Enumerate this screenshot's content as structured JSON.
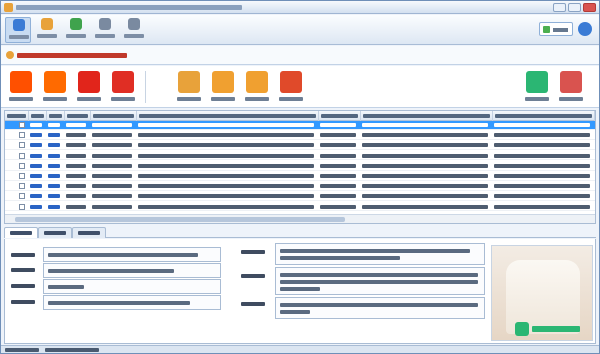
{
  "accent_colors": {
    "selected_row": "#3399ff",
    "link": "#2a64c5",
    "notice": "#c0392b"
  },
  "toolbar": {
    "buttons": [
      {
        "icon": "home-icon",
        "color": "#3a7bd5"
      },
      {
        "icon": "video-tutorial-icon",
        "color": "#e8a23a"
      },
      {
        "icon": "qq-group-icon",
        "color": "#3fa34d"
      },
      {
        "icon": "run-log-icon",
        "color": "#7a8aa0"
      },
      {
        "icon": "register-icon",
        "color": "#7a8aa0"
      }
    ],
    "skin_icon": "skin-icon",
    "help_icon": "help-icon"
  },
  "stores": [
    {
      "icon": "taobao-logo",
      "color": "#ff5000"
    },
    {
      "icon": "1688-logo",
      "color": "#ff6a00"
    },
    {
      "icon": "jd-logo",
      "color": "#e1251b"
    },
    {
      "icon": "pinduoduo-logo",
      "color": "#e02e24"
    },
    {
      "icon": "store-login-icon",
      "color": "#e8a23a"
    },
    {
      "icon": "category-match-icon",
      "color": "#f0a030"
    },
    {
      "icon": "batch-edit-icon",
      "color": "#f0a030"
    },
    {
      "icon": "upload-product-icon",
      "color": "#e04a2a"
    },
    {
      "icon": "refresh-list-icon",
      "color": "#2bb673"
    },
    {
      "icon": "delete-list-icon",
      "color": "#d9534f"
    }
  ],
  "table": {
    "row_count": 9,
    "selected_row": 0
  }
}
